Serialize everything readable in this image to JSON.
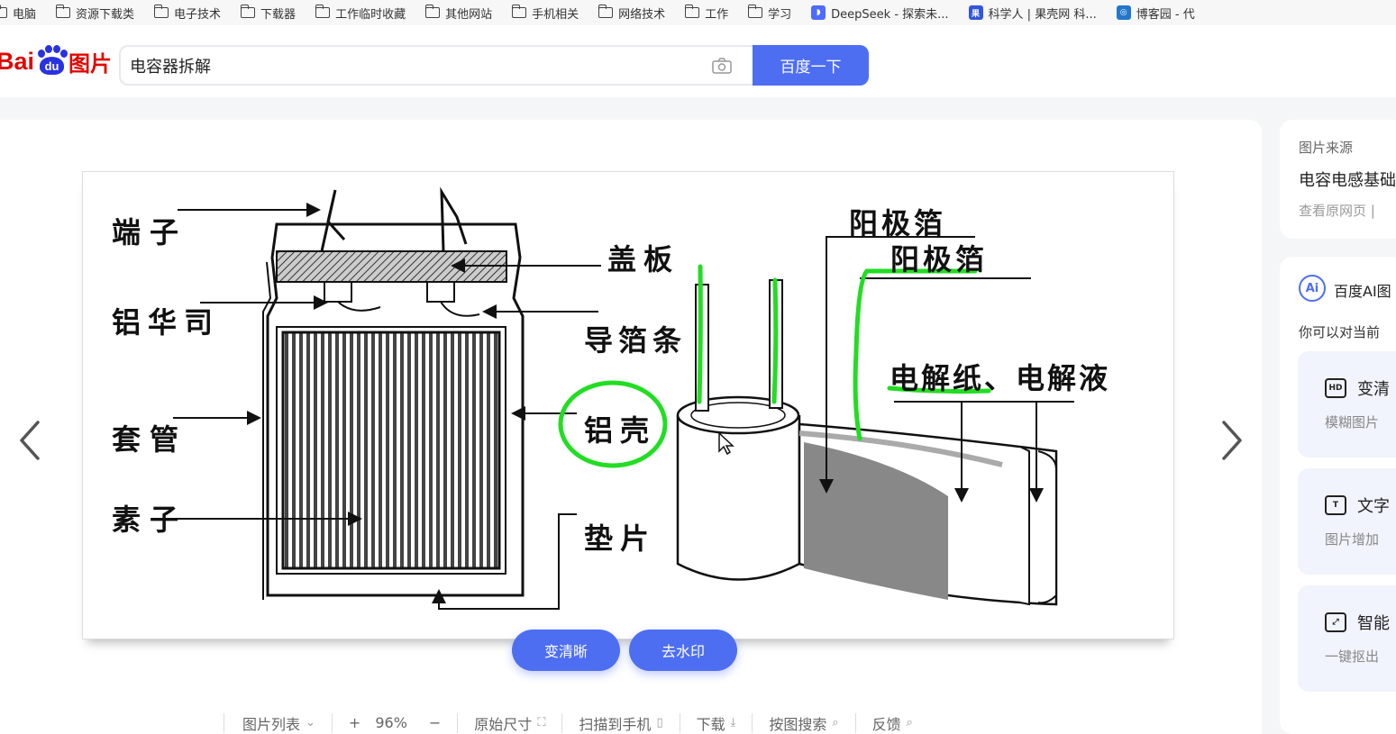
{
  "bookmarks": [
    {
      "label": "电脑",
      "icon": "folder-icon"
    },
    {
      "label": "资源下载类",
      "icon": "folder-icon"
    },
    {
      "label": "电子技术",
      "icon": "folder-icon"
    },
    {
      "label": "下载器",
      "icon": "folder-icon"
    },
    {
      "label": "工作临时收藏",
      "icon": "folder-icon"
    },
    {
      "label": "其他网站",
      "icon": "folder-icon"
    },
    {
      "label": "手机相关",
      "icon": "folder-icon"
    },
    {
      "label": "网络技术",
      "icon": "folder-icon"
    },
    {
      "label": "工作",
      "icon": "folder-icon"
    },
    {
      "label": "学习",
      "icon": "folder-icon"
    },
    {
      "label": "DeepSeek - 探索未...",
      "icon": "deepseek-icon"
    },
    {
      "label": "科学人 | 果壳网 科...",
      "icon": "guokr-icon"
    },
    {
      "label": "博客园 - 代",
      "icon": "cnblogs-icon"
    }
  ],
  "header": {
    "logo_bai": "Bai",
    "logo_du": "du",
    "logo_pic": "图片",
    "search_value": "电容器拆解",
    "search_button": "百度一下"
  },
  "diagram": {
    "labels": {
      "terminal": "端子",
      "washer": "铝华司",
      "sleeve": "套管",
      "element": "素子",
      "cover": "盖板",
      "lead_strip": "导箔条",
      "shell": "铝壳",
      "gasket": "垫片",
      "anode_foil_1": "阳极箔",
      "anode_foil_2": "阳极箔",
      "paper_electrolyte": "电解纸、电解液"
    }
  },
  "actions": {
    "enhance": "变清晰",
    "remove_watermark": "去水印"
  },
  "toolbar": {
    "list": "图片列表",
    "zoom_in": "+",
    "zoom_level": "96%",
    "zoom_out": "−",
    "original_size": "原始尺寸",
    "scan_to_phone": "扫描到手机",
    "download": "下载",
    "search_by_image": "按图搜索",
    "feedback": "反馈"
  },
  "sidebar": {
    "source_label": "图片来源",
    "source_title": "电容电感基础",
    "source_link": "查看原网页 |",
    "ai_title": "百度AI图",
    "ai_desc": "你可以对当前",
    "ai_items": [
      {
        "title": "变清",
        "desc": "模糊图片",
        "icon": "hd-icon"
      },
      {
        "title": "文字",
        "desc": "图片增加",
        "icon": "text-icon"
      },
      {
        "title": "智能",
        "desc": "一键抠出",
        "icon": "cutout-icon"
      }
    ]
  },
  "colors": {
    "accent": "#4e6ef2",
    "annotation_green": "#22dd22",
    "baidu_red": "#e10601",
    "baidu_blue": "#2932e1"
  }
}
